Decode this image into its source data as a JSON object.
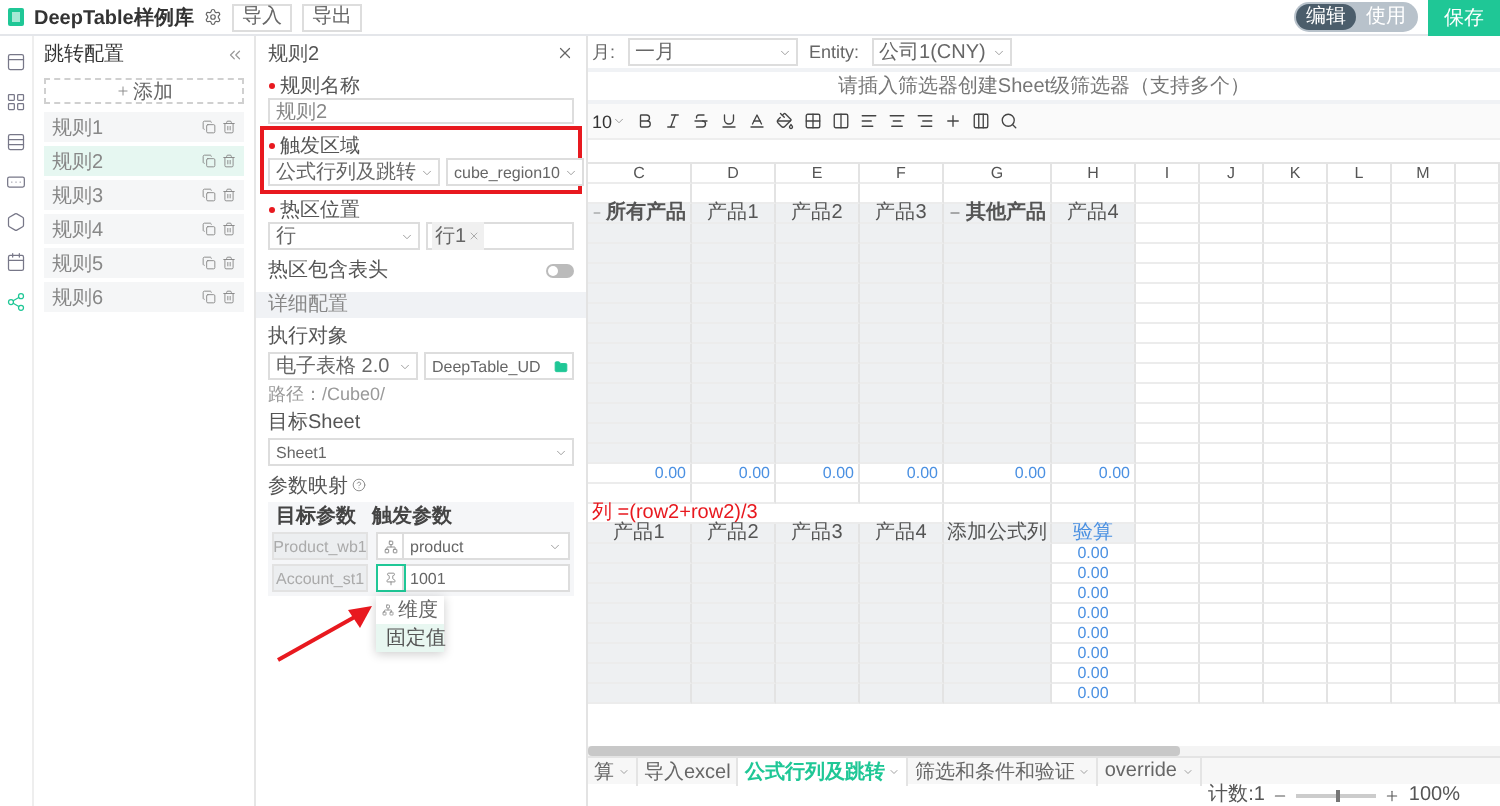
{
  "top_bar": {
    "app_title": "DeepTable样例库",
    "buttons": [
      "导入",
      "导出"
    ],
    "mode_switch": [
      {
        "label": "编辑",
        "selected": true
      },
      {
        "label": "使用",
        "selected": false
      }
    ],
    "save_button": "保存"
  },
  "rail_items": [
    {
      "selected": false
    },
    {
      "selected": false
    },
    {
      "selected": false
    },
    {
      "selected": false
    },
    {
      "selected": false
    },
    {
      "selected": false
    },
    {
      "selected": true
    }
  ],
  "sidebar": {
    "title": "跳转配置",
    "add_button": "添加",
    "rules": [
      {
        "label": "规则1",
        "selected": false
      },
      {
        "label": "规则2",
        "selected": true
      },
      {
        "label": "规则3",
        "selected": false
      },
      {
        "label": "规则4",
        "selected": false
      },
      {
        "label": "规则5",
        "selected": false
      },
      {
        "label": "规则6",
        "selected": false
      }
    ]
  },
  "rule_panel": {
    "title": "规则2",
    "name_field": {
      "label": "规则名称",
      "required": true,
      "value": "规则2"
    },
    "trigger_area": {
      "label": "触发区域",
      "required": true,
      "highlighted": true,
      "selects": [
        "公式行列及跳转",
        "cube_region10"
      ]
    },
    "hotspot": {
      "label": "热区位置",
      "required": true,
      "select": "行",
      "tags": [
        "行1"
      ]
    },
    "include_header": {
      "label": "热区包含表头",
      "on": false
    },
    "detail_section": "详细配置",
    "exec_target": {
      "label": "执行对象",
      "select": "电子表格 2.0",
      "file": "DeepTable_UD",
      "path": "路径：/Cube0/"
    },
    "target_sheet": {
      "label": "目标Sheet",
      "select": "Sheet1"
    },
    "param_map": {
      "label": "参数映射",
      "columns": [
        "目标参数",
        "触发参数"
      ],
      "rows": [
        {
          "target": "Product_wb1",
          "kind": "dimension",
          "value": "product",
          "dropdown": true,
          "focused": false
        },
        {
          "target": "Account_st1",
          "kind": "fixed",
          "value": "1001",
          "dropdown": false,
          "focused": true
        }
      ]
    },
    "source_menu": [
      {
        "label": "维度",
        "kind": "dimension",
        "selected": false
      },
      {
        "label": "固定值",
        "kind": "fixed",
        "selected": true
      }
    ]
  },
  "spreadsheet": {
    "filters": [
      {
        "label": "月:",
        "value": "一月"
      },
      {
        "label": "Entity:",
        "value": "公司1(CNY)"
      }
    ],
    "hint": "请插入筛选器创建Sheet级筛选器（支持多个）",
    "font_size": "10",
    "columns": [
      "C",
      "D",
      "E",
      "F",
      "G",
      "H",
      "I",
      "J",
      "K",
      "L",
      "M"
    ],
    "rows": [
      {
        "kind": "blank",
        "cells": []
      },
      {
        "kind": "header",
        "cells": [
          {
            "text": "所有产品",
            "kind": "group"
          },
          {
            "text": "产品1",
            "kind": "label"
          },
          {
            "text": "产品2",
            "kind": "label"
          },
          {
            "text": "产品3",
            "kind": "label"
          },
          {
            "text": "其他产品",
            "kind": "group"
          },
          {
            "text": "产品4",
            "kind": "label"
          }
        ]
      },
      {
        "kind": "grey",
        "cells": []
      },
      {
        "kind": "grey",
        "cells": []
      },
      {
        "kind": "grey",
        "cells": []
      },
      {
        "kind": "grey",
        "cells": []
      },
      {
        "kind": "grey",
        "cells": []
      },
      {
        "kind": "grey",
        "cells": []
      },
      {
        "kind": "grey",
        "cells": []
      },
      {
        "kind": "grey",
        "cells": []
      },
      {
        "kind": "grey",
        "cells": []
      },
      {
        "kind": "grey",
        "cells": []
      },
      {
        "kind": "grey",
        "cells": []
      },
      {
        "kind": "grey",
        "cells": []
      },
      {
        "kind": "value",
        "cells": [
          {
            "text": "0.00",
            "kind": "value"
          },
          {
            "text": "0.00",
            "kind": "value"
          },
          {
            "text": "0.00",
            "kind": "value"
          },
          {
            "text": "0.00",
            "kind": "value"
          },
          {
            "text": "0.00",
            "kind": "value"
          },
          {
            "text": "0.00",
            "kind": "value"
          }
        ]
      },
      {
        "kind": "blank",
        "cells": []
      },
      {
        "kind": "formula",
        "cells": [
          {
            "text": "列 =(row2+row2)/3",
            "kind": "formula"
          }
        ]
      },
      {
        "kind": "header",
        "cells": [
          {
            "text": "产品1",
            "kind": "label"
          },
          {
            "text": "产品2",
            "kind": "label"
          },
          {
            "text": "产品3",
            "kind": "label"
          },
          {
            "text": "产品4",
            "kind": "label"
          },
          {
            "text": "添加公式列",
            "kind": "label"
          },
          {
            "text": "验算",
            "kind": "check"
          }
        ]
      },
      {
        "kind": "result",
        "cells": [
          {
            "text": "0.00",
            "kind": "check"
          }
        ]
      },
      {
        "kind": "result",
        "cells": [
          {
            "text": "0.00",
            "kind": "check"
          }
        ]
      },
      {
        "kind": "result",
        "cells": [
          {
            "text": "0.00",
            "kind": "check"
          }
        ]
      },
      {
        "kind": "result",
        "cells": [
          {
            "text": "0.00",
            "kind": "check"
          }
        ]
      },
      {
        "kind": "result",
        "cells": [
          {
            "text": "0.00",
            "kind": "check"
          }
        ]
      },
      {
        "kind": "result",
        "cells": [
          {
            "text": "0.00",
            "kind": "check"
          }
        ]
      },
      {
        "kind": "result",
        "cells": [
          {
            "text": "0.00",
            "kind": "check"
          }
        ]
      },
      {
        "kind": "result",
        "cells": [
          {
            "text": "0.00",
            "kind": "check"
          }
        ]
      }
    ],
    "sheet_tabs": [
      {
        "label": "算",
        "selected": false,
        "menu": true
      },
      {
        "label": "导入excel",
        "selected": false,
        "menu": false
      },
      {
        "label": "公式行列及跳转",
        "selected": true,
        "menu": true
      },
      {
        "label": "筛选和条件和验证",
        "selected": false,
        "menu": true
      },
      {
        "label": "override",
        "selected": false,
        "menu": true
      }
    ],
    "status_bar": {
      "count": "计数:1",
      "zoom": {
        "level": 0.5,
        "reading": "100%"
      }
    }
  }
}
